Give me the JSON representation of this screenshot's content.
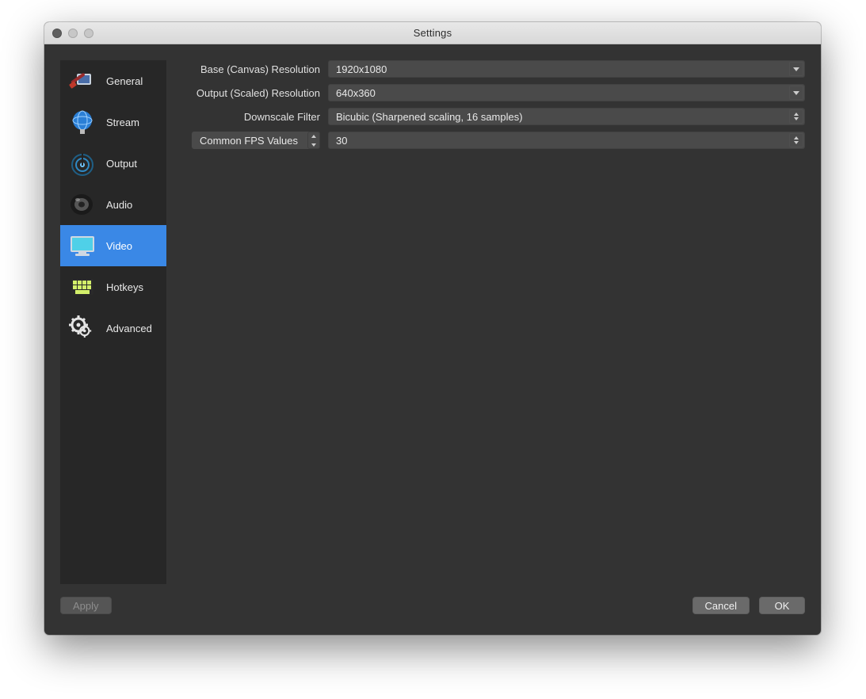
{
  "window": {
    "title": "Settings"
  },
  "sidebar": {
    "items": [
      {
        "label": "General",
        "icon": "general-icon"
      },
      {
        "label": "Stream",
        "icon": "stream-icon"
      },
      {
        "label": "Output",
        "icon": "output-icon"
      },
      {
        "label": "Audio",
        "icon": "audio-icon"
      },
      {
        "label": "Video",
        "icon": "video-icon",
        "selected": true
      },
      {
        "label": "Hotkeys",
        "icon": "hotkeys-icon"
      },
      {
        "label": "Advanced",
        "icon": "advanced-icon"
      }
    ]
  },
  "settings": {
    "base_resolution": {
      "label": "Base (Canvas) Resolution",
      "value": "1920x1080"
    },
    "output_resolution": {
      "label": "Output (Scaled) Resolution",
      "value": "640x360"
    },
    "downscale_filter": {
      "label": "Downscale Filter",
      "value": "Bicubic (Sharpened scaling, 16 samples)"
    },
    "fps_mode": {
      "label": "Common FPS Values"
    },
    "fps_value": {
      "value": "30"
    }
  },
  "footer": {
    "apply": "Apply",
    "cancel": "Cancel",
    "ok": "OK"
  }
}
